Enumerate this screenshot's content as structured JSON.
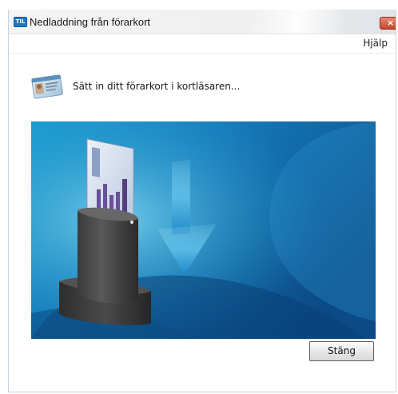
{
  "window": {
    "title": "Nedladdning från förarkort",
    "app_icon_text": "TIL"
  },
  "menu": {
    "help": "Hjälp"
  },
  "content": {
    "instruction": "Sätt in ditt förarkort i kortläsaren...",
    "illustration_icon": "card-reader-insert-icon"
  },
  "buttons": {
    "close": "Stäng",
    "window_close_glyph": "×"
  },
  "colors": {
    "illustration_dark": "#0a4f86",
    "illustration_light": "#36b6dc",
    "close_red": "#c7462a"
  }
}
